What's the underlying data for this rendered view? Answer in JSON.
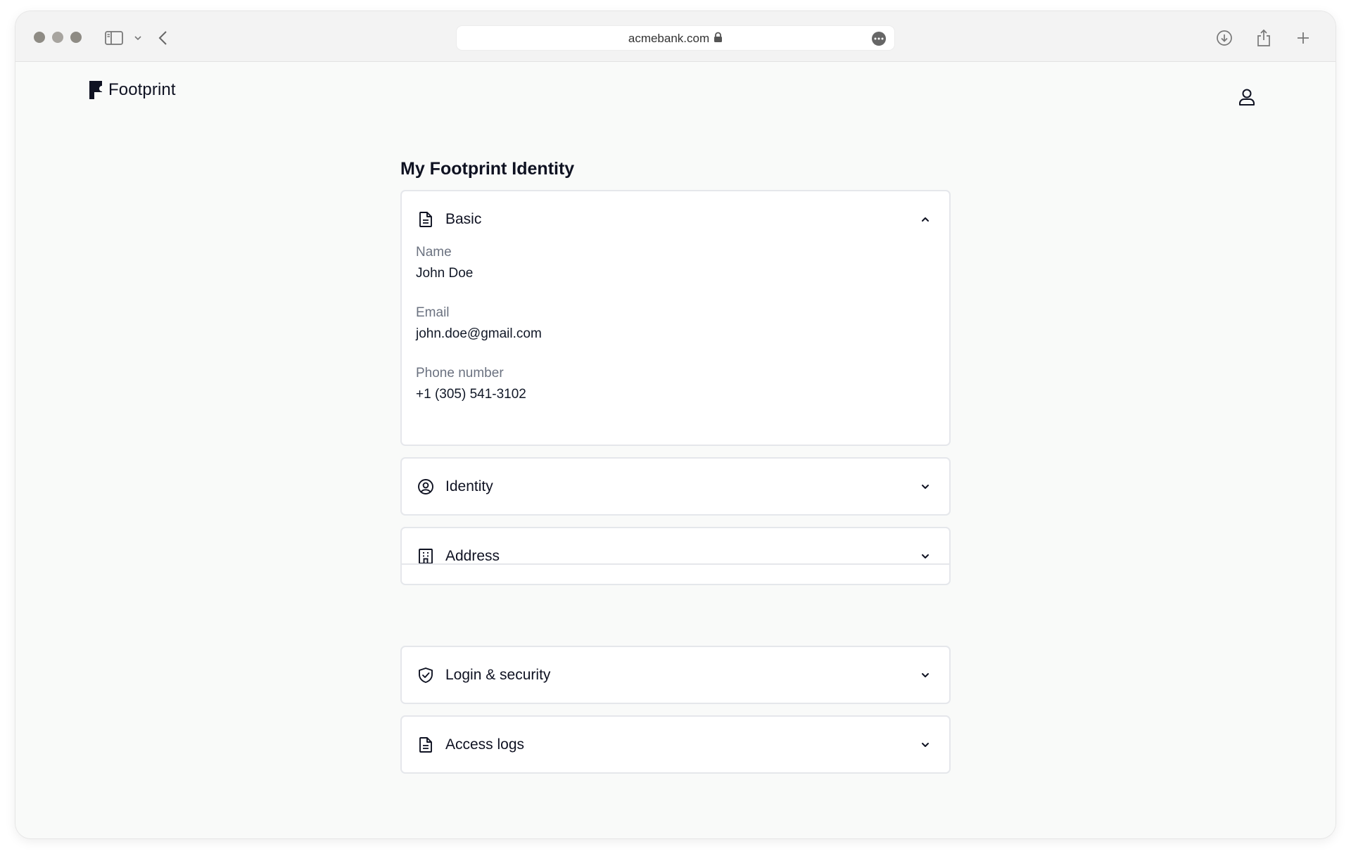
{
  "browser": {
    "url": "acmebank.com"
  },
  "header": {
    "brand": "Footprint"
  },
  "main": {
    "title": "My Footprint Identity",
    "sections": {
      "basic": {
        "title": "Basic",
        "expanded": true,
        "fields": [
          {
            "label": "Name",
            "value": "John Doe"
          },
          {
            "label": "Email",
            "value": "john.doe@gmail.com"
          },
          {
            "label": "Phone number",
            "value": "+1 (305) 541-3102"
          }
        ]
      },
      "identity": {
        "title": "Identity",
        "expanded": false
      },
      "address": {
        "title": "Address",
        "expanded": false
      },
      "login_security": {
        "title": "Login & security",
        "expanded": false
      },
      "access_logs": {
        "title": "Access logs",
        "expanded": false
      }
    }
  },
  "icons": {
    "basic": "document-icon",
    "identity": "user-circle-icon",
    "address": "building-icon",
    "login_security": "shield-check-icon",
    "access_logs": "document-icon",
    "account": "user-icon"
  },
  "colors": {
    "page_bg": "#f9faf9",
    "card_border": "#e5e7eb",
    "text_primary": "#0f1222",
    "text_muted": "#6b7280"
  }
}
